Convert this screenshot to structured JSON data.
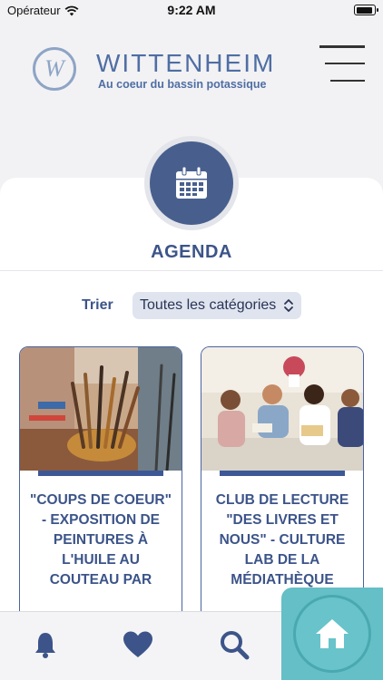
{
  "status_bar": {
    "carrier": "Opérateur",
    "time": "9:22 AM"
  },
  "header": {
    "logo_letter": "W",
    "logo_name": "WITTENHEIM",
    "logo_tagline": "Au coeur du bassin potassique"
  },
  "page": {
    "title": "AGENDA",
    "icon": "calendar-icon"
  },
  "sort": {
    "label": "Trier",
    "selected": "Toutes les catégories"
  },
  "events": [
    {
      "title": "\"COUPS DE COEUR\" - EXPOSITION DE PEINTURES À L'HUILE AU COUTEAU PAR"
    },
    {
      "title": "CLUB DE LECTURE \"DES LIVRES ET NOUS\" - CULTURE LAB DE LA MÉDIATHÈQUE"
    }
  ],
  "tab_bar": {
    "icons": [
      "bell-icon",
      "heart-icon",
      "search-icon",
      "home-icon"
    ]
  },
  "colors": {
    "primary": "#3c5489",
    "badge": "#485f8e",
    "accent_teal": "#65bfc6",
    "logo": "#4f6ea4"
  }
}
